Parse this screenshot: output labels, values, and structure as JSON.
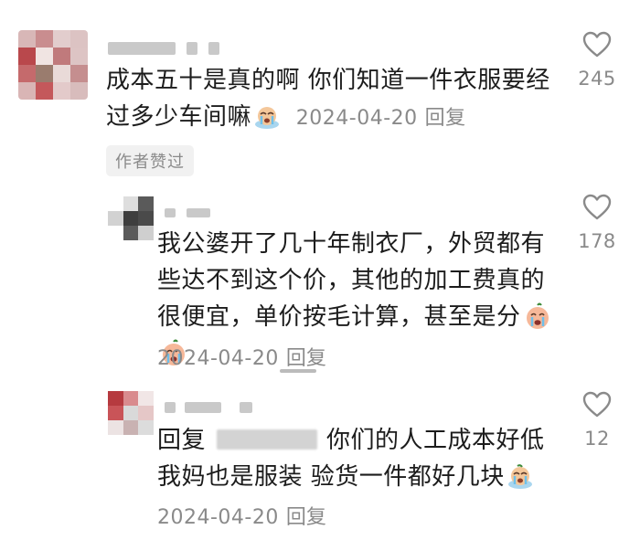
{
  "comments": [
    {
      "text": "成本五十是真的啊 你们知道一件衣服要经过多少车间嘛",
      "date": "2024-04-20",
      "reply_label": "回复",
      "badge": "作者赞过",
      "likes": "245",
      "emoji": "crying-emoji"
    },
    {
      "text": "我公婆开了几十年制衣厂，外贸都有些达不到这个价，其他的加工费真的很便宜，单价按毛计算，甚至是分",
      "date": "2024-04-20",
      "reply_label": "回复",
      "likes": "178",
      "emoji": "crying-face-emoji"
    },
    {
      "reply_prefix": "回复",
      "text": "你们的人工成本好低 我妈也是服装 验货一件都好几块",
      "date": "2024-04-20",
      "reply_label": "回复",
      "likes": "12",
      "emoji": "crying-emoji"
    }
  ],
  "colors": {
    "text": "#1c1c1c",
    "meta": "#8a8a8a",
    "badge_bg": "#f1f1f1",
    "heart": "#8a8a8a"
  },
  "icons": {
    "like": "heart-outline-icon"
  }
}
